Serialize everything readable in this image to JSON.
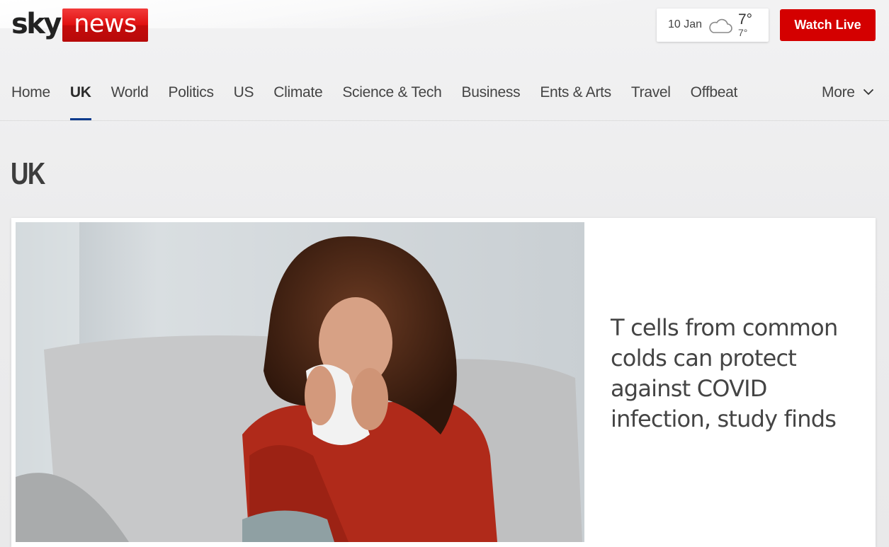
{
  "brand": {
    "sky": "sky",
    "news": "news",
    "accent": "#d40000"
  },
  "weather": {
    "date": "10 Jan",
    "icon": "cloud-icon",
    "high": "7°",
    "low": "7°"
  },
  "header": {
    "watch_live_label": "Watch Live"
  },
  "nav": {
    "items": [
      {
        "label": "Home",
        "active": false
      },
      {
        "label": "UK",
        "active": true
      },
      {
        "label": "World",
        "active": false
      },
      {
        "label": "Politics",
        "active": false
      },
      {
        "label": "US",
        "active": false
      },
      {
        "label": "Climate",
        "active": false
      },
      {
        "label": "Science & Tech",
        "active": false
      },
      {
        "label": "Business",
        "active": false
      },
      {
        "label": "Ents & Arts",
        "active": false
      },
      {
        "label": "Travel",
        "active": false
      },
      {
        "label": "Offbeat",
        "active": false
      }
    ],
    "more_label": "More",
    "active_underline_color": "#0a3a8c"
  },
  "page": {
    "title": "UK"
  },
  "hero": {
    "headline": "T cells from common colds can protect against COVID infection, study finds"
  }
}
